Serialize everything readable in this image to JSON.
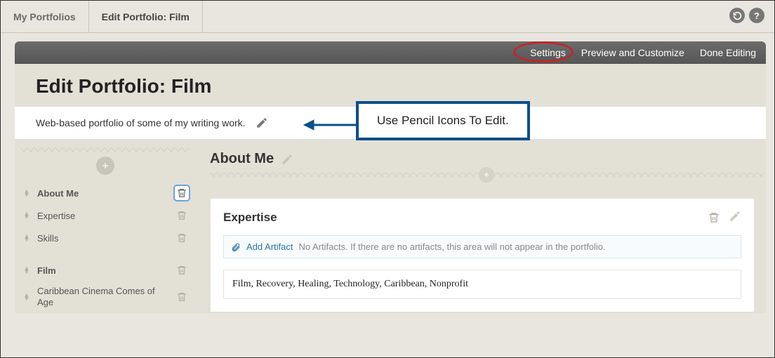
{
  "topbar": {
    "my_portfolios": "My Portfolios",
    "edit_label": "Edit Portfolio: Film"
  },
  "greybar": {
    "settings": "Settings",
    "preview": "Preview and Customize",
    "done": "Done Editing"
  },
  "page_title": "Edit Portfolio: Film",
  "description": "Web-based portfolio of some of my writing work.",
  "callout_text": "Use Pencil Icons To Edit.",
  "sidebar": {
    "items": [
      {
        "label": "About Me"
      },
      {
        "label": "Expertise"
      },
      {
        "label": "Skills"
      }
    ],
    "items2": [
      {
        "label": "Film"
      },
      {
        "label": "Caribbean Cinema Comes of Age"
      }
    ]
  },
  "section": {
    "about_me": "About Me",
    "expertise": "Expertise",
    "add_artifact": "Add Artifact",
    "no_artifacts": "No Artifacts. If there are no artifacts, this area will not appear in the portfolio.",
    "tags": "Film, Recovery, Healing, Technology, Caribbean, Nonprofit"
  }
}
